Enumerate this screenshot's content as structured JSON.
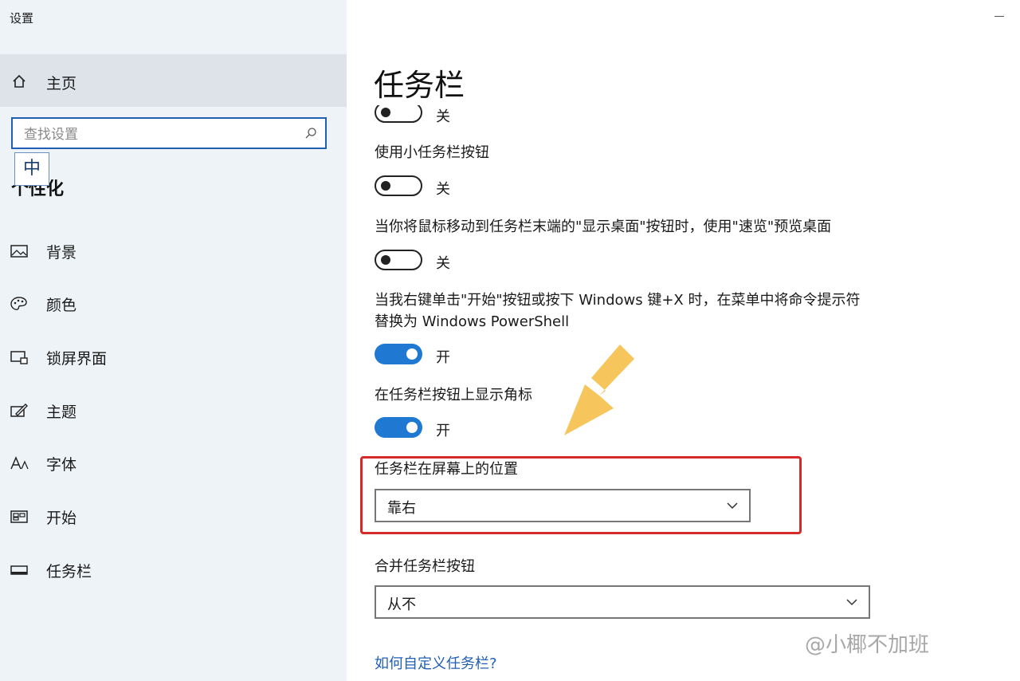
{
  "app": {
    "title": "设置"
  },
  "sidebar": {
    "home_label": "主页",
    "search_placeholder": "查找设置",
    "ime_indicator": "中",
    "section_title": "个性化",
    "items": [
      {
        "label": "背景",
        "icon": "image-icon"
      },
      {
        "label": "颜色",
        "icon": "palette-icon"
      },
      {
        "label": "锁屏界面",
        "icon": "lock-screen-icon"
      },
      {
        "label": "主题",
        "icon": "theme-brush-icon"
      },
      {
        "label": "字体",
        "icon": "font-icon"
      },
      {
        "label": "开始",
        "icon": "start-grid-icon"
      },
      {
        "label": "任务栏",
        "icon": "taskbar-icon"
      }
    ]
  },
  "main": {
    "title": "任务栏",
    "settings": [
      {
        "label": "",
        "state": "关",
        "on": false
      },
      {
        "label": "使用小任务栏按钮",
        "state": "关",
        "on": false
      },
      {
        "label": "当你将鼠标移动到任务栏末端的\"显示桌面\"按钮时，使用\"速览\"预览桌面",
        "state": "关",
        "on": false
      },
      {
        "label": "当我右键单击\"开始\"按钮或按下 Windows 键+X 时，在菜单中将命令提示符替换为 Windows PowerShell",
        "state": "开",
        "on": true
      },
      {
        "label": "在任务栏按钮上显示角标",
        "state": "开",
        "on": true
      }
    ],
    "position": {
      "label": "任务栏在屏幕上的位置",
      "value": "靠右"
    },
    "combine": {
      "label": "合并任务栏按钮",
      "value": "从不"
    },
    "help_link": "如何自定义任务栏?"
  },
  "annotation": {
    "highlight_color": "#d42a2a",
    "arrow_color": "#f5c04a"
  },
  "watermark": "@小椰不加班"
}
